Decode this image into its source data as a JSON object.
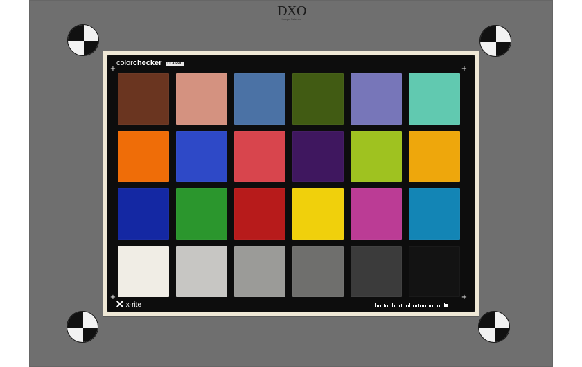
{
  "header": {
    "brand_main": "DXO",
    "brand_sub": "Image Science"
  },
  "card": {
    "title_prefix": "color",
    "title_suffix": "checker",
    "title_tag": "CLASSIC",
    "footer_brand": "x·rite"
  },
  "swatches": [
    {
      "name": "dark-skin",
      "color": "#6a3520"
    },
    {
      "name": "light-skin",
      "color": "#d49280"
    },
    {
      "name": "blue-sky",
      "color": "#4b72a5"
    },
    {
      "name": "foliage",
      "color": "#415b13"
    },
    {
      "name": "blue-flower",
      "color": "#7776b9"
    },
    {
      "name": "bluish-green",
      "color": "#61c9b0"
    },
    {
      "name": "orange",
      "color": "#ef6d08"
    },
    {
      "name": "purplish-blue",
      "color": "#2e49c7"
    },
    {
      "name": "moderate-red",
      "color": "#d8454d"
    },
    {
      "name": "purple",
      "color": "#3f175f"
    },
    {
      "name": "yellow-green",
      "color": "#9fc220"
    },
    {
      "name": "orange-yellow",
      "color": "#eea70c"
    },
    {
      "name": "blue",
      "color": "#1428a3"
    },
    {
      "name": "green",
      "color": "#2b962d"
    },
    {
      "name": "red",
      "color": "#b71b1b"
    },
    {
      "name": "yellow",
      "color": "#f0d00c"
    },
    {
      "name": "magenta",
      "color": "#bb3c95"
    },
    {
      "name": "cyan",
      "color": "#1385b5"
    },
    {
      "name": "white",
      "color": "#f0ede5"
    },
    {
      "name": "neutral-8",
      "color": "#c7c6c3"
    },
    {
      "name": "neutral-6-5",
      "color": "#9b9b98"
    },
    {
      "name": "neutral-5",
      "color": "#6f6f6d"
    },
    {
      "name": "neutral-3-5",
      "color": "#3b3b3b"
    },
    {
      "name": "black",
      "color": "#131313"
    }
  ]
}
